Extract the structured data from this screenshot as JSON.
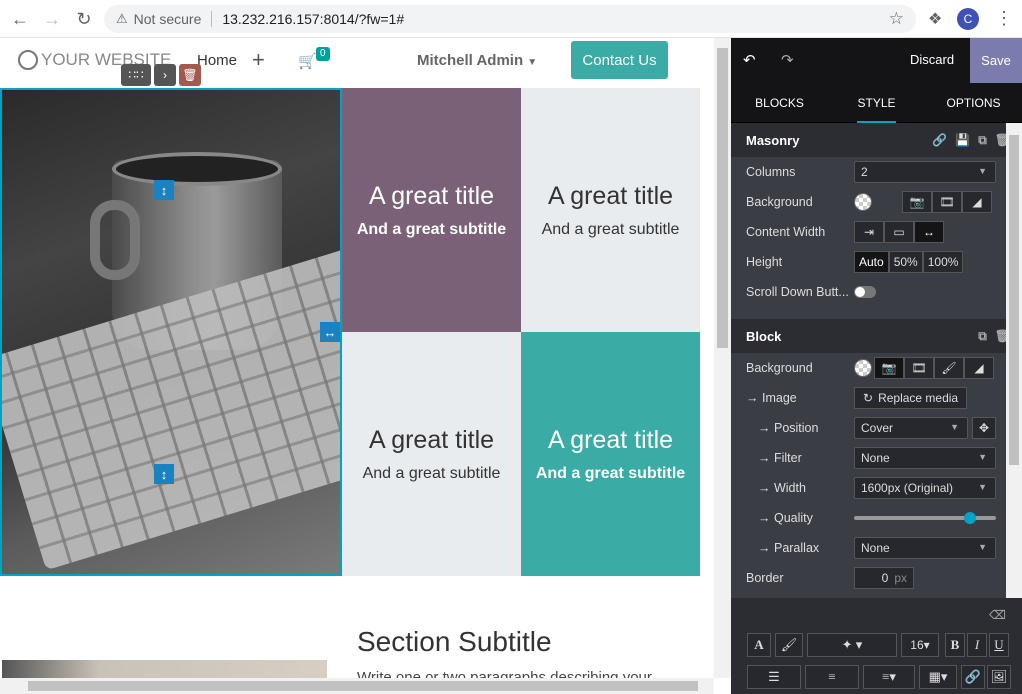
{
  "browser": {
    "security_label": "Not secure",
    "url": "13.232.216.157:8014/?fw=1#",
    "profile_initial": "C"
  },
  "site": {
    "logo_text": "YOUR WEBSITE",
    "nav_home": "Home",
    "cart_count": "0",
    "user_name": "Mitchell Admin",
    "contact_label": "Contact Us"
  },
  "masonry": {
    "tiles": [
      {
        "title": "A great title",
        "subtitle": "And a great subtitle"
      },
      {
        "title": "A great title",
        "subtitle": "And a great subtitle"
      },
      {
        "title": "A great title",
        "subtitle": "And a great subtitle"
      },
      {
        "title": "A great title",
        "subtitle": "And a great subtitle"
      }
    ]
  },
  "section": {
    "subtitle": "Section Subtitle",
    "paragraph": "Write one or two paragraphs describing your"
  },
  "panel": {
    "discard": "Discard",
    "save": "Save",
    "tabs": [
      "BLOCKS",
      "STYLE",
      "OPTIONS"
    ],
    "active_tab": "STYLE",
    "masonry_section": {
      "title": "Masonry",
      "columns_label": "Columns",
      "columns_value": "2",
      "background_label": "Background",
      "content_width_label": "Content Width",
      "height_label": "Height",
      "height_options": [
        "Auto",
        "50%",
        "100%"
      ],
      "height_selected": "Auto",
      "scroll_down_label": "Scroll Down Butt..."
    },
    "block_section": {
      "title": "Block",
      "background_label": "Background",
      "image_label": "Image",
      "replace_media": "Replace media",
      "position_label": "Position",
      "position_value": "Cover",
      "filter_label": "Filter",
      "filter_value": "None",
      "width_label": "Width",
      "width_value": "1600px (Original)",
      "quality_label": "Quality",
      "quality_level": 0.82,
      "parallax_label": "Parallax",
      "parallax_value": "None",
      "border_label": "Border",
      "border_value": "0",
      "border_unit": "px"
    },
    "toolbar": {
      "font_size": "16",
      "bold": "B",
      "italic": "I",
      "underline": "U"
    }
  }
}
